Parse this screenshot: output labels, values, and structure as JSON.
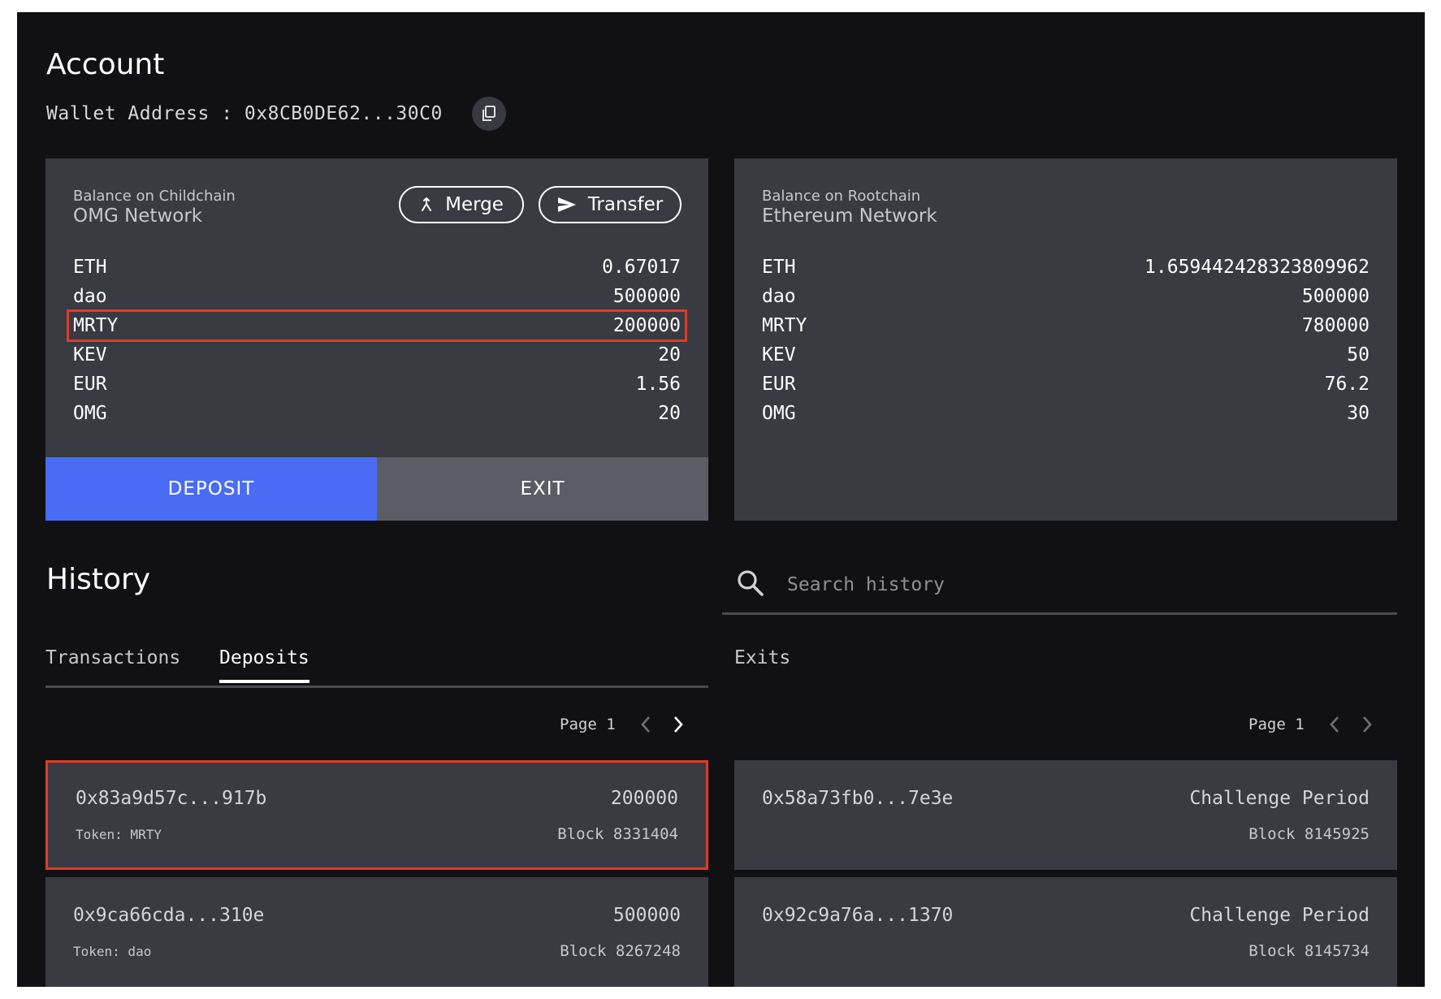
{
  "account": {
    "title": "Account",
    "wallet_label": "Wallet Address : 0x8CB0DE62...30C0"
  },
  "childchain": {
    "subtitle": "Balance on Childchain",
    "network": "OMG Network",
    "merge_label": "Merge",
    "transfer_label": "Transfer",
    "balances": [
      {
        "token": "ETH",
        "amount": "0.67017"
      },
      {
        "token": "dao",
        "amount": "500000"
      },
      {
        "token": "MRTY",
        "amount": "200000"
      },
      {
        "token": "KEV",
        "amount": "20"
      },
      {
        "token": "EUR",
        "amount": "1.56"
      },
      {
        "token": "OMG",
        "amount": "20"
      }
    ],
    "deposit_label": "DEPOSIT",
    "exit_label": "EXIT"
  },
  "rootchain": {
    "subtitle": "Balance on Rootchain",
    "network": "Ethereum Network",
    "balances": [
      {
        "token": "ETH",
        "amount": "1.659442428323809962"
      },
      {
        "token": "dao",
        "amount": "500000"
      },
      {
        "token": "MRTY",
        "amount": "780000"
      },
      {
        "token": "KEV",
        "amount": "50"
      },
      {
        "token": "EUR",
        "amount": "76.2"
      },
      {
        "token": "OMG",
        "amount": "30"
      }
    ]
  },
  "history": {
    "title": "History",
    "search_placeholder": "Search history",
    "tabs": [
      "Transactions",
      "Deposits"
    ],
    "exits_label": "Exits",
    "deposits_page": "Page 1",
    "exits_page": "Page 1",
    "deposits": [
      {
        "hash": "0x83a9d57c...917b",
        "amount": "200000",
        "token": "Token: MRTY",
        "block": "Block 8331404"
      },
      {
        "hash": "0x9ca66cda...310e",
        "amount": "500000",
        "token": "Token: dao",
        "block": "Block 8267248"
      }
    ],
    "exits": [
      {
        "hash": "0x58a73fb0...7e3e",
        "status": "Challenge Period",
        "block": "Block 8145925"
      },
      {
        "hash": "0x92c9a76a...1370",
        "status": "Challenge Period",
        "block": "Block 8145734"
      }
    ]
  },
  "colors": {
    "background": "#111113",
    "panel": "#393a42",
    "deposit_button": "#4a6cf5",
    "exit_button": "#5b5c66",
    "highlight": "#e23a26"
  },
  "icons": {
    "copy": "copy-icon",
    "merge": "merge-icon",
    "transfer": "send-icon",
    "search": "search-icon",
    "prev": "chevron-left-icon",
    "next": "chevron-right-icon"
  }
}
